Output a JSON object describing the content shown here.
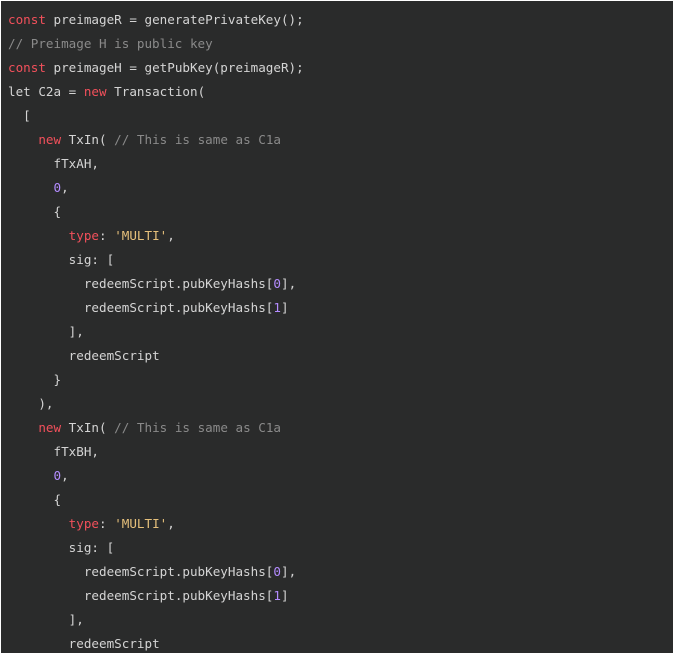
{
  "colors": {
    "background": "#2a2b2b",
    "plain": "#d4d4d4",
    "keyword": "#f2505b",
    "comment": "#8a8a8a",
    "string": "#e6c07b",
    "number": "#b48cff"
  },
  "code": {
    "lines": [
      {
        "indent": "",
        "tokens": [
          {
            "t": "keyword",
            "v": "const"
          },
          {
            "t": "plain",
            "v": " preimageR = generatePrivateKey();"
          }
        ]
      },
      {
        "indent": "",
        "tokens": [
          {
            "t": "comment",
            "v": "// Preimage H is public key"
          }
        ]
      },
      {
        "indent": "",
        "tokens": [
          {
            "t": "keyword",
            "v": "const"
          },
          {
            "t": "plain",
            "v": " preimageH = getPubKey(preimageR);"
          }
        ]
      },
      {
        "indent": "",
        "tokens": [
          {
            "t": "plain",
            "v": "let C2a = "
          },
          {
            "t": "keyword",
            "v": "new"
          },
          {
            "t": "plain",
            "v": " Transaction("
          }
        ]
      },
      {
        "indent": "  ",
        "tokens": [
          {
            "t": "plain",
            "v": "["
          }
        ]
      },
      {
        "indent": "    ",
        "tokens": [
          {
            "t": "keyword",
            "v": "new"
          },
          {
            "t": "plain",
            "v": " TxIn( "
          },
          {
            "t": "comment",
            "v": "// This is same as C1a"
          }
        ]
      },
      {
        "indent": "      ",
        "tokens": [
          {
            "t": "plain",
            "v": "fTxAH,"
          }
        ]
      },
      {
        "indent": "      ",
        "tokens": [
          {
            "t": "number",
            "v": "0"
          },
          {
            "t": "plain",
            "v": ","
          }
        ]
      },
      {
        "indent": "      ",
        "tokens": [
          {
            "t": "plain",
            "v": "{"
          }
        ]
      },
      {
        "indent": "        ",
        "tokens": [
          {
            "t": "keyword",
            "v": "type"
          },
          {
            "t": "plain",
            "v": ": "
          },
          {
            "t": "string",
            "v": "'MULTI'"
          },
          {
            "t": "plain",
            "v": ","
          }
        ]
      },
      {
        "indent": "        ",
        "tokens": [
          {
            "t": "plain",
            "v": "sig: ["
          }
        ]
      },
      {
        "indent": "          ",
        "tokens": [
          {
            "t": "plain",
            "v": "redeemScript.pubKeyHashs["
          },
          {
            "t": "number",
            "v": "0"
          },
          {
            "t": "plain",
            "v": "],"
          }
        ]
      },
      {
        "indent": "          ",
        "tokens": [
          {
            "t": "plain",
            "v": "redeemScript.pubKeyHashs["
          },
          {
            "t": "number",
            "v": "1"
          },
          {
            "t": "plain",
            "v": "]"
          }
        ]
      },
      {
        "indent": "        ",
        "tokens": [
          {
            "t": "plain",
            "v": "],"
          }
        ]
      },
      {
        "indent": "        ",
        "tokens": [
          {
            "t": "plain",
            "v": "redeemScript"
          }
        ]
      },
      {
        "indent": "      ",
        "tokens": [
          {
            "t": "plain",
            "v": "}"
          }
        ]
      },
      {
        "indent": "    ",
        "tokens": [
          {
            "t": "plain",
            "v": "),"
          }
        ]
      },
      {
        "indent": "    ",
        "tokens": [
          {
            "t": "keyword",
            "v": "new"
          },
          {
            "t": "plain",
            "v": " TxIn( "
          },
          {
            "t": "comment",
            "v": "// This is same as C1a"
          }
        ]
      },
      {
        "indent": "      ",
        "tokens": [
          {
            "t": "plain",
            "v": "fTxBH,"
          }
        ]
      },
      {
        "indent": "      ",
        "tokens": [
          {
            "t": "number",
            "v": "0"
          },
          {
            "t": "plain",
            "v": ","
          }
        ]
      },
      {
        "indent": "      ",
        "tokens": [
          {
            "t": "plain",
            "v": "{"
          }
        ]
      },
      {
        "indent": "        ",
        "tokens": [
          {
            "t": "keyword",
            "v": "type"
          },
          {
            "t": "plain",
            "v": ": "
          },
          {
            "t": "string",
            "v": "'MULTI'"
          },
          {
            "t": "plain",
            "v": ","
          }
        ]
      },
      {
        "indent": "        ",
        "tokens": [
          {
            "t": "plain",
            "v": "sig: ["
          }
        ]
      },
      {
        "indent": "          ",
        "tokens": [
          {
            "t": "plain",
            "v": "redeemScript.pubKeyHashs["
          },
          {
            "t": "number",
            "v": "0"
          },
          {
            "t": "plain",
            "v": "],"
          }
        ]
      },
      {
        "indent": "          ",
        "tokens": [
          {
            "t": "plain",
            "v": "redeemScript.pubKeyHashs["
          },
          {
            "t": "number",
            "v": "1"
          },
          {
            "t": "plain",
            "v": "]"
          }
        ]
      },
      {
        "indent": "        ",
        "tokens": [
          {
            "t": "plain",
            "v": "],"
          }
        ]
      },
      {
        "indent": "        ",
        "tokens": [
          {
            "t": "plain",
            "v": "redeemScript"
          }
        ]
      }
    ]
  }
}
